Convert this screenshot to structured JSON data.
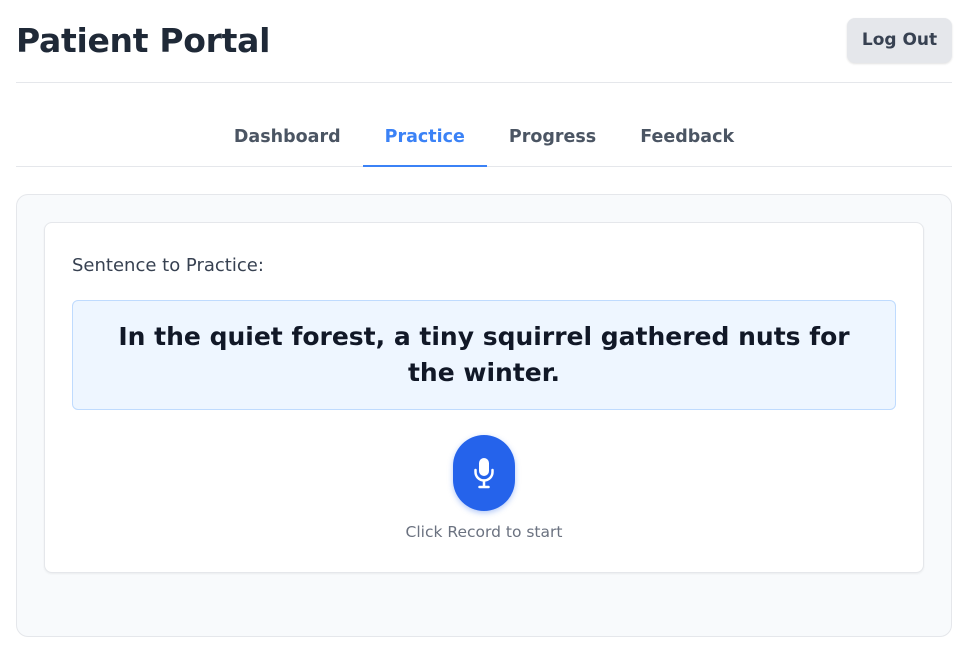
{
  "header": {
    "title": "Patient Portal",
    "logout_label": "Log Out"
  },
  "tabs": [
    {
      "label": "Dashboard",
      "active": false
    },
    {
      "label": "Practice",
      "active": true
    },
    {
      "label": "Progress",
      "active": false
    },
    {
      "label": "Feedback",
      "active": false
    }
  ],
  "practice": {
    "sentence_label": "Sentence to Practice:",
    "sentence": "In the quiet forest, a tiny squirrel gathered nuts for the winter.",
    "record_icon": "microphone-icon",
    "status": "Click Record to start"
  },
  "colors": {
    "accent": "#3b82f6",
    "record_button": "#2563eb",
    "sentence_bg": "#eef6ff"
  }
}
